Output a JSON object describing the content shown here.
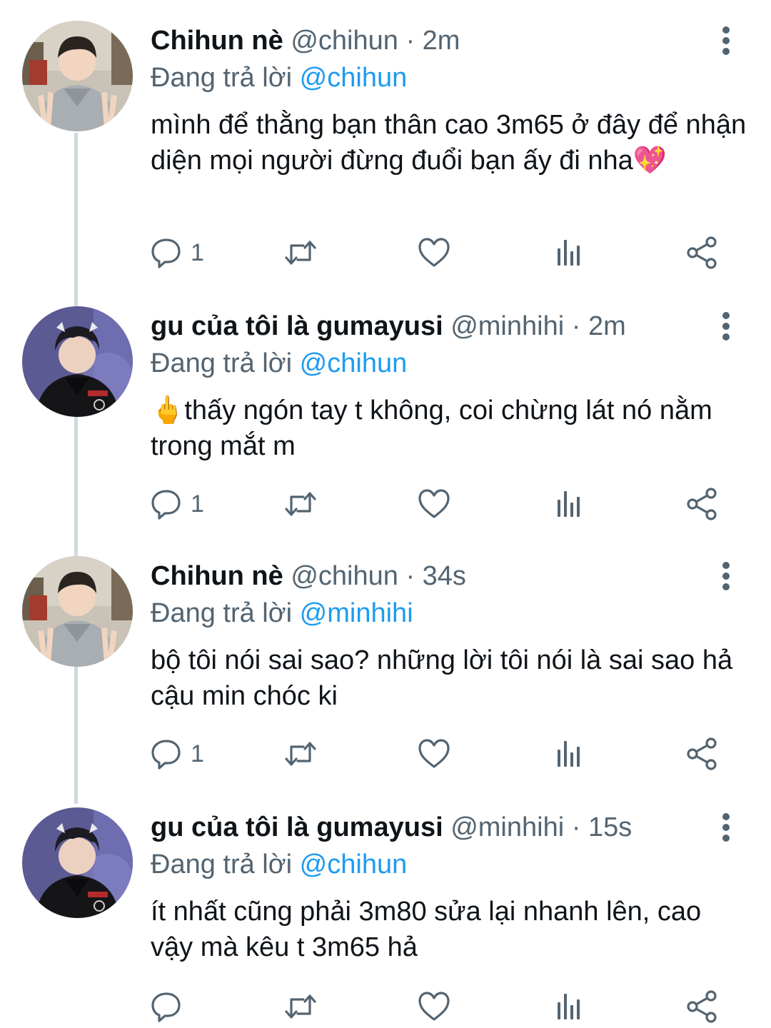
{
  "colors": {
    "name": "#0f1419",
    "secondary": "#536471",
    "link": "#1d9bf0",
    "thread_line": "#cfd9de"
  },
  "icons": [
    "reply-icon",
    "retweet-icon",
    "like-icon",
    "views-icon",
    "share-icon",
    "more-icon"
  ],
  "tweets": [
    {
      "name": "Chihun nè",
      "handle": "@chihun",
      "time": "· 2m",
      "replying_prefix": "Đang trả lời",
      "replying_to": "@chihun",
      "text_parts": [
        "mình để thằng bạn thân cao 3m65 ở đây để nhận diện mọi người đừng đuổi bạn ấy đi nha",
        "💖"
      ],
      "reply_count": "1"
    },
    {
      "name": "gu của tôi là gumayusi",
      "handle": "@minhihi",
      "time": "· 2m",
      "replying_prefix": "Đang trả lời",
      "replying_to": "@chihun",
      "text_parts": [
        "🖕",
        "thấy ngón tay t không, coi chừng lát nó nằm trong mắt m"
      ],
      "reply_count": "1"
    },
    {
      "name": "Chihun nè",
      "handle": "@chihun",
      "time": "· 34s",
      "replying_prefix": "Đang trả lời",
      "replying_to": "@minhihi",
      "text_parts": [
        "bộ tôi nói sai sao? những lời tôi nói là sai sao hả cậu min chóc ki"
      ],
      "reply_count": "1"
    },
    {
      "name": "gu của tôi là gumayusi",
      "handle": "@minhihi",
      "time": "· 15s",
      "replying_prefix": "Đang trả lời",
      "replying_to": "@chihun",
      "text_parts": [
        "ít nhất cũng phải 3m80 sửa lại nhanh lên, cao vậy mà kêu t 3m65 hả"
      ],
      "reply_count": ""
    }
  ]
}
